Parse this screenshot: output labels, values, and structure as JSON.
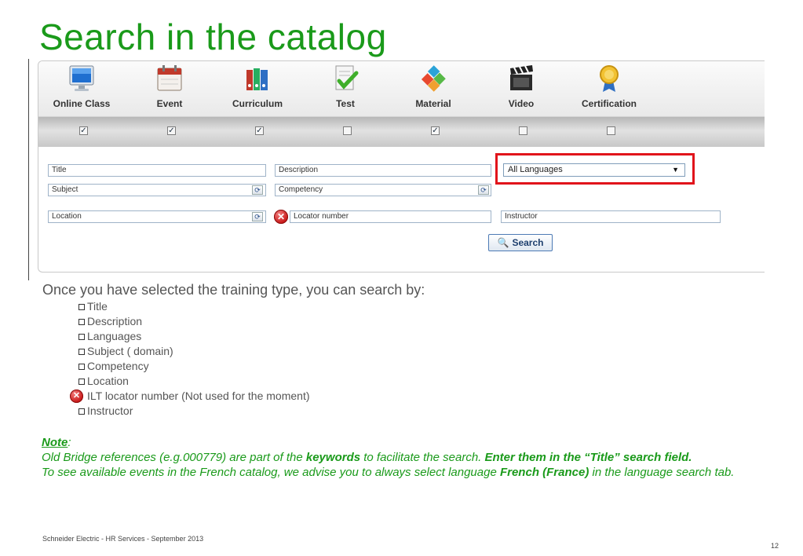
{
  "slide": {
    "title": "Search in the catalog",
    "intro": "Once you have selected the training type, you can search by:",
    "criteria": [
      "Title",
      "Description",
      "Languages",
      "Subject ( domain)",
      "Competency",
      "Location",
      "ILT locator number (Not used for the moment)",
      "Instructor"
    ],
    "note": {
      "head": "Note",
      "colon": ":",
      "line1_pre": "Old Bridge references (e.g.000779) are part of the ",
      "line1_bold": "keywords",
      "line1_mid": " to facilitate the search. ",
      "line1_bold2": "Enter them in the “Title” search field.",
      "line2_pre": "To see available events in the French catalog, we advise you to always select language ",
      "line2_bold": "French (France)",
      "line2_post": " in the language search tab."
    },
    "footer": "Schneider Electric - HR Services - September 2013",
    "page_number": "12"
  },
  "training_types": [
    {
      "label": "Online Class",
      "icon": "monitor-icon",
      "checked": true
    },
    {
      "label": "Event",
      "icon": "calendar-icon",
      "checked": true
    },
    {
      "label": "Curriculum",
      "icon": "binders-icon",
      "checked": true
    },
    {
      "label": "Test",
      "icon": "test-sheet-icon",
      "checked": false
    },
    {
      "label": "Material",
      "icon": "cubes-icon",
      "checked": true
    },
    {
      "label": "Video",
      "icon": "clapperboard-icon",
      "checked": false
    },
    {
      "label": "Certification",
      "icon": "medal-icon",
      "checked": false
    }
  ],
  "search_form": {
    "title_placeholder": "Title",
    "description_placeholder": "Description",
    "language_selected": "All Languages",
    "subject_placeholder": "Subject",
    "competency_placeholder": "Competency",
    "location_placeholder": "Location",
    "locator_placeholder": "Locator number",
    "instructor_placeholder": "Instructor",
    "search_label": "Search"
  },
  "colors": {
    "title_green": "#1a9a1a",
    "highlight_red": "#e1141b"
  }
}
